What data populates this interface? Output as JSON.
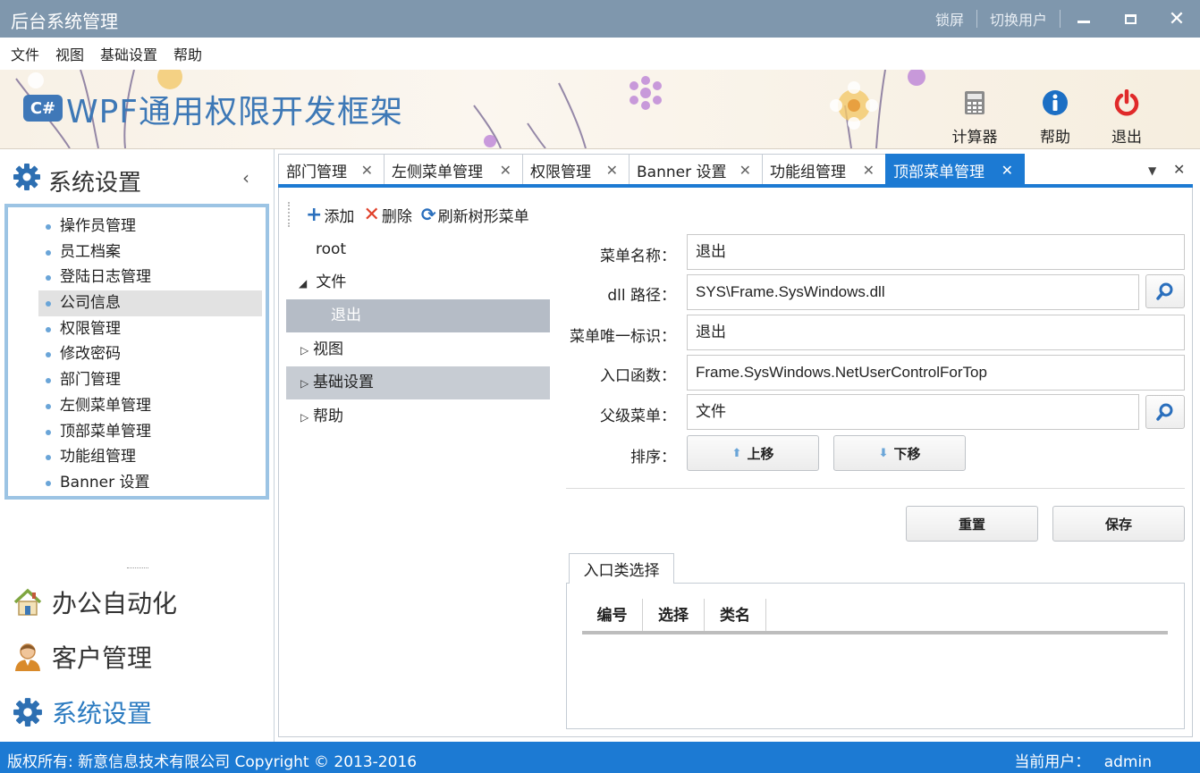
{
  "window": {
    "title": "后台系统管理",
    "lock_label": "锁屏",
    "switch_user_label": "切换用户"
  },
  "menubar": [
    "文件",
    "视图",
    "基础设置",
    "帮助"
  ],
  "banner": {
    "logo_text": "C#",
    "brand": "WPF通用权限开发框架",
    "tools": [
      {
        "label": "计算器",
        "icon": "calculator-icon"
      },
      {
        "label": "帮助",
        "icon": "info-icon"
      },
      {
        "label": "退出",
        "icon": "power-icon"
      }
    ]
  },
  "sidebar": {
    "header": "系统设置",
    "items": [
      "操作员管理",
      "员工档案",
      "登陆日志管理",
      "公司信息",
      "权限管理",
      "修改密码",
      "部门管理",
      "左侧菜单管理",
      "顶部菜单管理",
      "功能组管理",
      "Banner 设置"
    ],
    "active_index": 3,
    "groups": [
      {
        "label": "办公自动化",
        "icon": "house-icon"
      },
      {
        "label": "客户管理",
        "icon": "user-icon"
      },
      {
        "label": "系统设置",
        "icon": "gear-icon"
      }
    ]
  },
  "tabs": [
    "部门管理",
    "左侧菜单管理",
    "权限管理",
    "Banner 设置",
    "功能组管理",
    "顶部菜单管理"
  ],
  "active_tab": 5,
  "toolbar": {
    "add": "添加",
    "delete": "删除",
    "refresh": "刷新树形菜单"
  },
  "tree": {
    "root": "root",
    "file": "文件",
    "exit": "退出",
    "view": "视图",
    "basic": "基础设置",
    "help": "帮助"
  },
  "form": {
    "name_label": "菜单名称：",
    "name_value": "退出",
    "dll_label": "dll 路径：",
    "dll_value": "SYS\\Frame.SysWindows.dll",
    "uid_label": "菜单唯一标识：",
    "uid_value": "退出",
    "entry_label": "入口函数：",
    "entry_value": "Frame.SysWindows.NetUserControlForTop",
    "parent_label": "父级菜单：",
    "parent_value": "文件",
    "sort_label": "排序：",
    "move_up": "上移",
    "move_down": "下移",
    "reset": "重置",
    "save": "保存"
  },
  "entry_selector": {
    "tab_label": "入口类选择",
    "columns": [
      "编号",
      "选择",
      "类名"
    ]
  },
  "status": {
    "copyright": "版权所有: 新意信息技术有限公司  Copyright © 2013-2016",
    "current_user_label": "当前用户：",
    "current_user": "admin"
  },
  "colors": {
    "accent": "#1c7ad3",
    "titlebar": "#7f97ad",
    "brand": "#3d78b6"
  }
}
